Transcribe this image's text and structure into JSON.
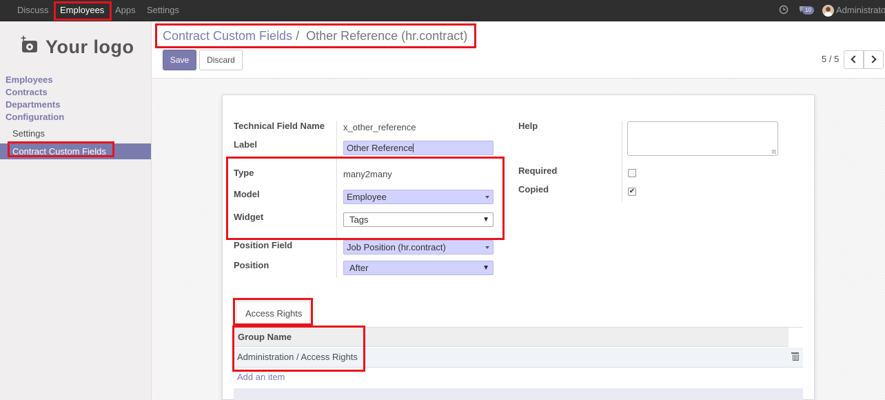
{
  "topbar": {
    "menus": [
      "Discuss",
      "Employees",
      "Apps",
      "Settings"
    ],
    "active_menu": "Employees",
    "notification_count": "10",
    "username": "Administrator"
  },
  "sidebar": {
    "logo_text": "Your logo",
    "sections": [
      "Employees",
      "Contracts",
      "Departments",
      "Configuration"
    ],
    "sub_items": [
      "Settings",
      "Contract Custom Fields"
    ],
    "active_item": "Contract Custom Fields"
  },
  "control_panel": {
    "breadcrumb_parent": "Contract Custom Fields",
    "breadcrumb_separator": "/",
    "breadcrumb_current": "Other Reference (hr.contract)",
    "save_label": "Save",
    "discard_label": "Discard",
    "pager": "5 / 5"
  },
  "form": {
    "technical_field_name_label": "Technical Field Name",
    "technical_field_name_value": "x_other_reference",
    "label_label": "Label",
    "label_value": "Other Reference",
    "type_label": "Type",
    "type_value": "many2many",
    "model_label": "Model",
    "model_value": "Employee",
    "widget_label": "Widget",
    "widget_value": "Tags",
    "position_field_label": "Position Field",
    "position_field_value": "Job Position (hr.contract)",
    "position_label": "Position",
    "position_value": "After",
    "help_label": "Help",
    "help_value": "",
    "required_label": "Required",
    "required_checked": false,
    "copied_label": "Copied",
    "copied_checked": true,
    "checked_mark": "✔"
  },
  "tabs": [
    {
      "label": "Access Rights",
      "active": true
    }
  ],
  "access_rights": {
    "column_header": "Group Name",
    "rows": [
      "Administration / Access Rights"
    ],
    "add_item_label": "Add an item"
  },
  "colors": {
    "brand": "#7c7bad",
    "highlight": "#e8131c",
    "input_bg": "#d2d2ff"
  }
}
